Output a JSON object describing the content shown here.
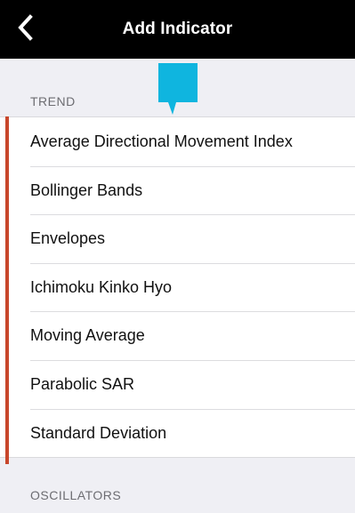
{
  "header": {
    "title": "Add Indicator",
    "back_icon": "chevron-left-icon"
  },
  "colors": {
    "nav_background": "#000000",
    "accent_bar": "#c8472c",
    "tooltip_marker": "#0fb5df",
    "page_background": "#efeff4"
  },
  "sections": [
    {
      "title": "TREND",
      "items": [
        {
          "label": "Average Directional Movement Index"
        },
        {
          "label": "Bollinger Bands"
        },
        {
          "label": "Envelopes"
        },
        {
          "label": "Ichimoku Kinko Hyo"
        },
        {
          "label": "Moving Average"
        },
        {
          "label": "Parabolic SAR"
        },
        {
          "label": "Standard Deviation"
        }
      ]
    },
    {
      "title": "OSCILLATORS",
      "items": []
    }
  ]
}
